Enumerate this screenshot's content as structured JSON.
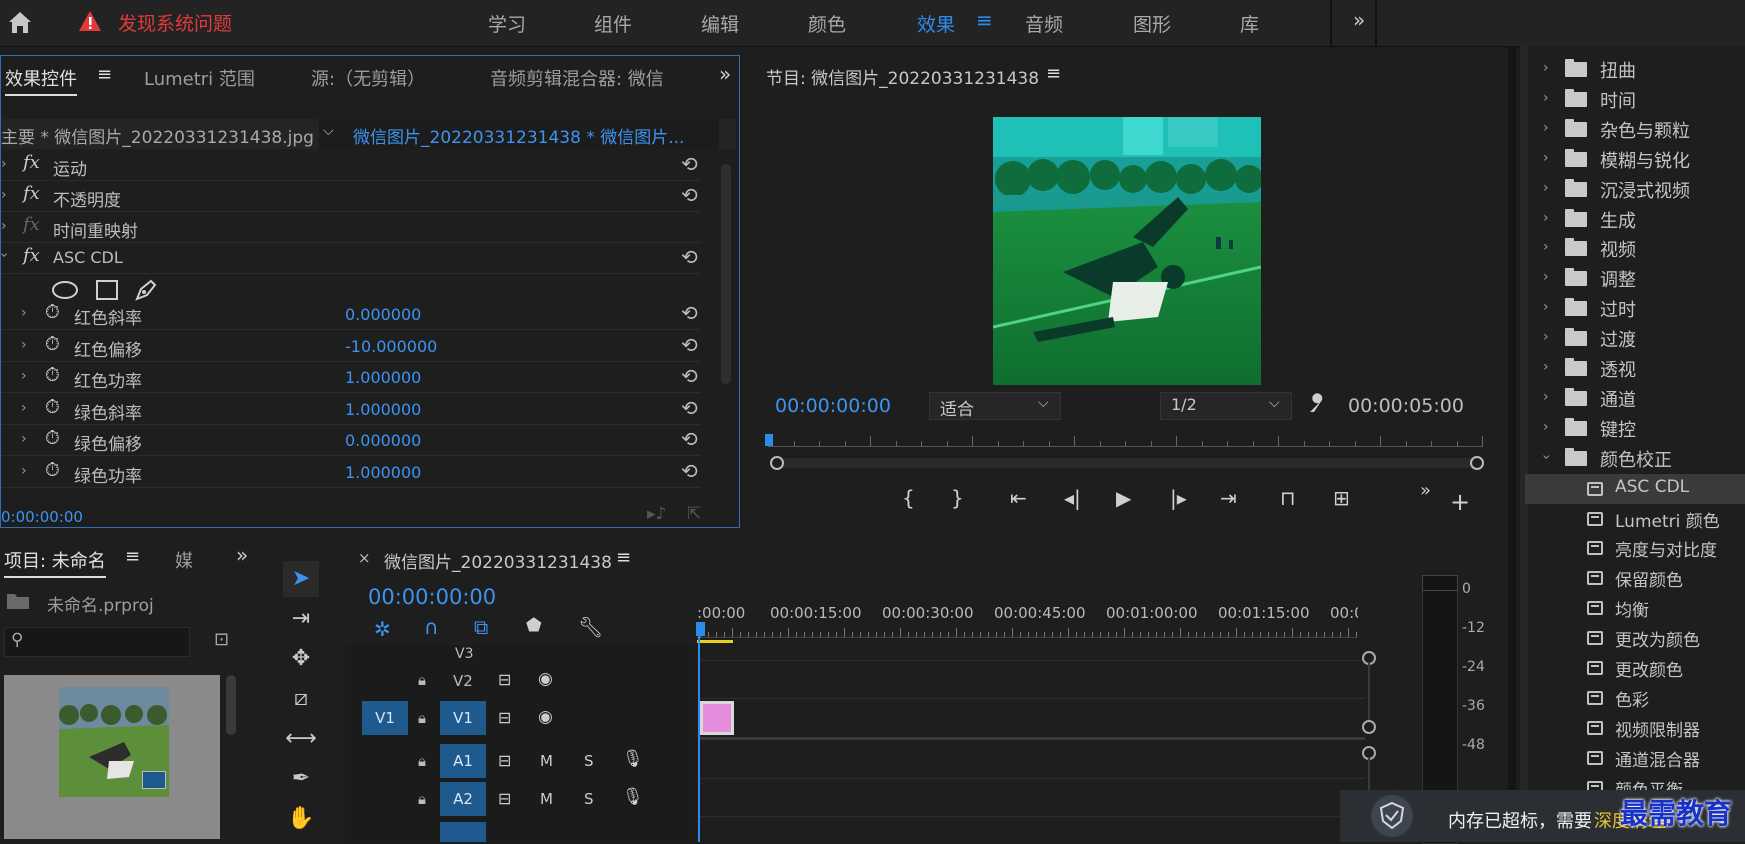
{
  "topbar": {
    "warning_text": "发现系统问题",
    "workspaces": [
      "学习",
      "组件",
      "编辑",
      "颜色",
      "效果",
      "音频",
      "图形",
      "库"
    ],
    "active_workspace": "效果",
    "more_icon": "double-chevron-right-icon"
  },
  "effect_controls": {
    "tabs": [
      "效果控件",
      "Lumetri 范围",
      "源:（无剪辑）",
      "音频剪辑混合器: 微信"
    ],
    "clip_master": "主要 * 微信图片_20220331231438.jpg",
    "clip_seq": "微信图片_20220331231438 * 微信图片...",
    "fx_rows": [
      {
        "label": "运动"
      },
      {
        "label": "不透明度"
      },
      {
        "label": "时间重映射"
      },
      {
        "label": "ASC CDL"
      }
    ],
    "params": [
      {
        "label": "红色斜率",
        "value": "0.000000"
      },
      {
        "label": "红色偏移",
        "value": "-10.000000"
      },
      {
        "label": "红色功率",
        "value": "1.000000"
      },
      {
        "label": "绿色斜率",
        "value": "1.000000"
      },
      {
        "label": "绿色偏移",
        "value": "0.000000"
      },
      {
        "label": "绿色功率",
        "value": "1.000000"
      }
    ],
    "timecode": "0:00:00:00"
  },
  "program_monitor": {
    "title": "节目: 微信图片_20220331231438",
    "timecode_current": "00:00:00:00",
    "fit_label": "适合",
    "resolution": "1/2",
    "timecode_duration": "00:00:05:00"
  },
  "project_panel": {
    "title": "项目: 未命名",
    "tab2": "媒",
    "file_name": "未命名.prproj"
  },
  "timeline": {
    "sequence_name": "微信图片_20220331231438",
    "timecode": "00:00:00:00",
    "ruler_labels": [
      ":00:00",
      "00:00:15:00",
      "00:00:30:00",
      "00:00:45:00",
      "00:01:00:00",
      "00:01:15:00",
      "00:0("
    ],
    "tracks_video": [
      "V3",
      "V2",
      "V1"
    ],
    "tracks_audio": [
      "A1",
      "A2"
    ],
    "source_patch": "V1",
    "audio_toggles": {
      "mute": "M",
      "solo": "S"
    }
  },
  "audio_meter": {
    "scale": [
      "0",
      "-12",
      "-24",
      "-36",
      "-48"
    ]
  },
  "effects_panel": {
    "folders": [
      "扭曲",
      "时间",
      "杂色与颗粒",
      "模糊与锐化",
      "沉浸式视频",
      "生成",
      "视频",
      "调整",
      "过时",
      "过渡",
      "透视",
      "通道",
      "键控",
      "颜色校正"
    ],
    "color_correction_items": [
      "ASC CDL",
      "Lumetri 颜色",
      "亮度与对比度",
      "保留颜色",
      "均衡",
      "更改为颜色",
      "更改颜色",
      "色彩",
      "视频限制器",
      "通道混合器",
      "颜色平衡"
    ],
    "selected_item": "ASC CDL"
  },
  "notification": {
    "text": "内存已超标，需要",
    "link": "深度清理"
  },
  "watermark": "最需教育",
  "colors": {
    "accent": "#2d8ceb",
    "warning": "#e03a3a",
    "clip": "#e58ddc",
    "track_blue": "#1f5a8e"
  }
}
